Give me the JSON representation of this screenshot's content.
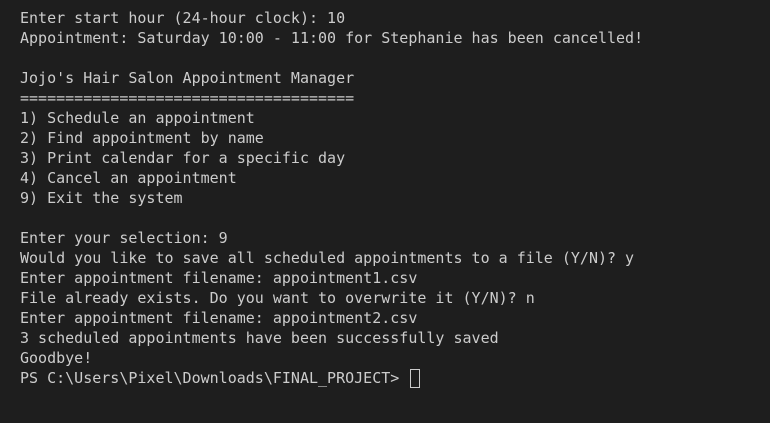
{
  "terminal": {
    "lines": [
      "Enter start hour (24-hour clock): 10",
      "Appointment: Saturday 10:00 - 11:00 for Stephanie has been cancelled!",
      "",
      "Jojo's Hair Salon Appointment Manager",
      "=====================================",
      "1) Schedule an appointment",
      "2) Find appointment by name",
      "3) Print calendar for a specific day",
      "4) Cancel an appointment",
      "9) Exit the system",
      "",
      "Enter your selection: 9",
      "Would you like to save all scheduled appointments to a file (Y/N)? y",
      "Enter appointment filename: appointment1.csv",
      "File already exists. Do you want to overwrite it (Y/N)? n",
      "Enter appointment filename: appointment2.csv",
      "3 scheduled appointments have been successfully saved",
      "Goodbye!"
    ],
    "prompt": "PS C:\\Users\\Pixel\\Downloads\\FINAL_PROJECT> "
  }
}
